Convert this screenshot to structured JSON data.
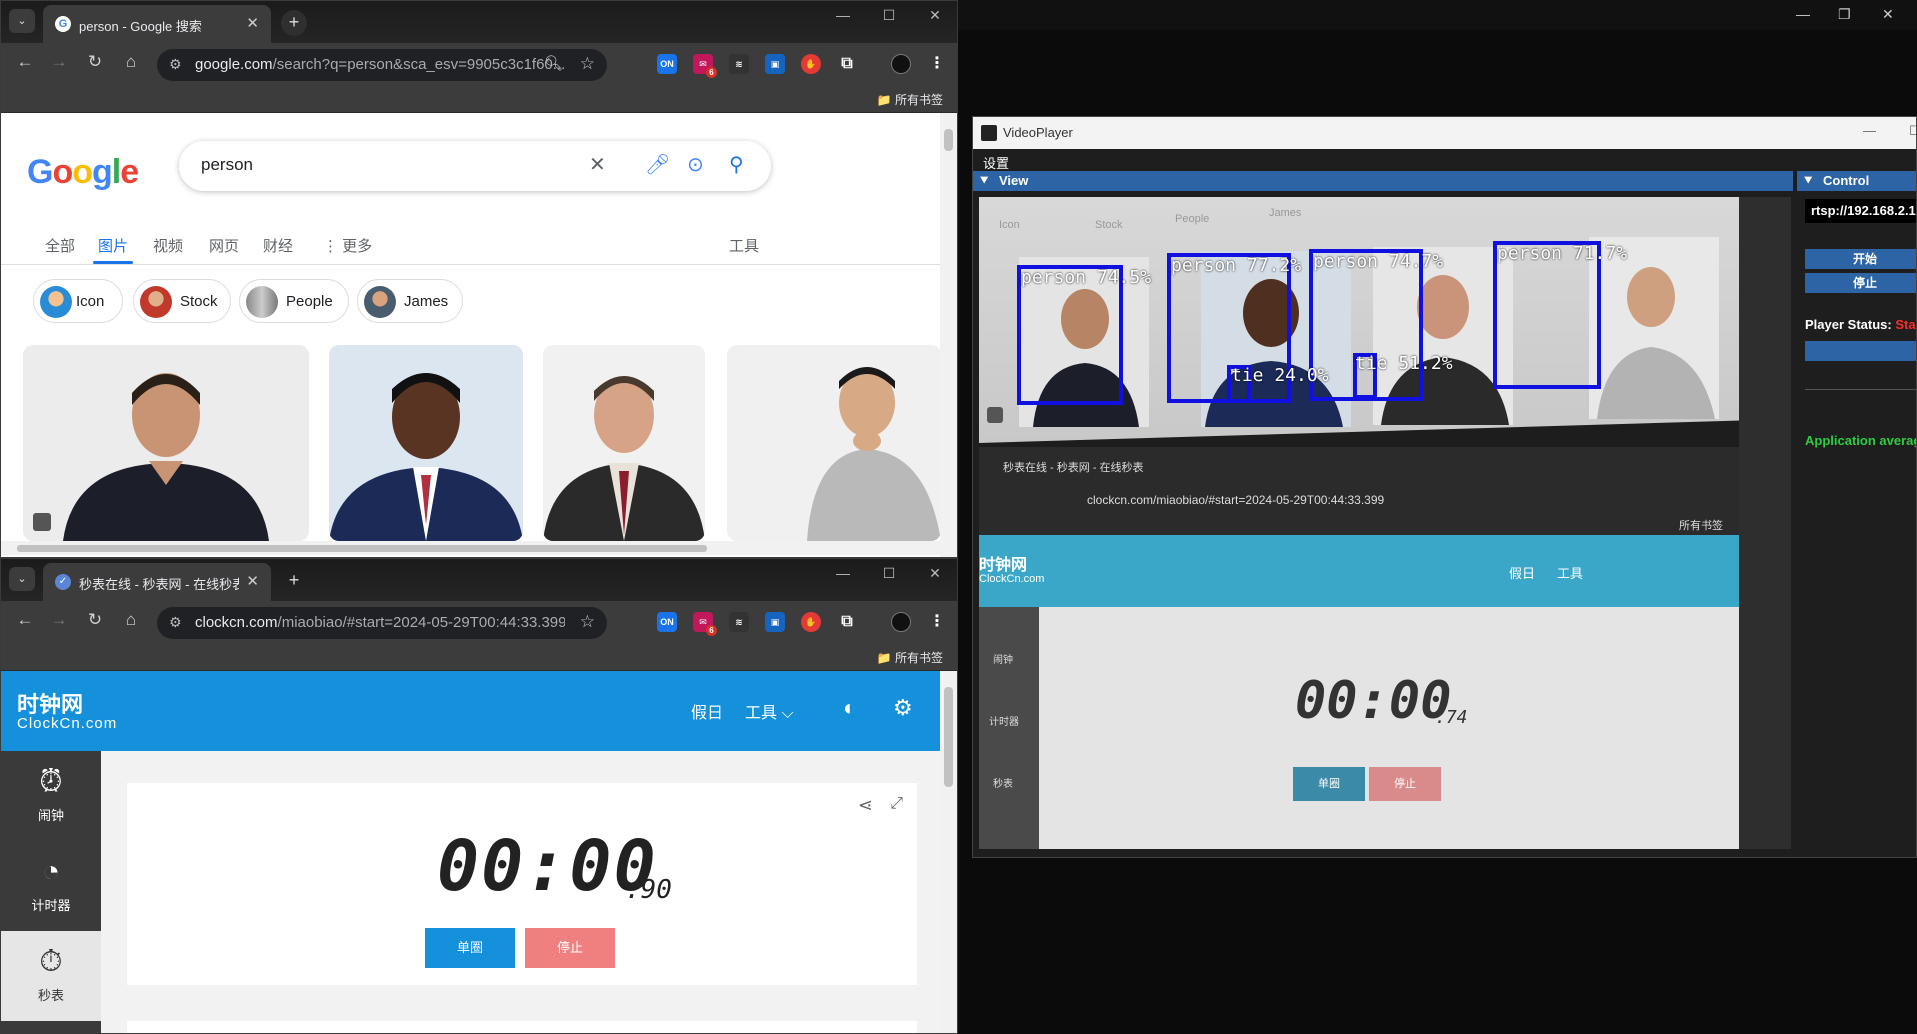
{
  "google_window": {
    "tab_title": "person - Google 搜索",
    "omnibox": {
      "url_main": "google.com",
      "url_rest": "/search?q=person&sca_esv=9905c3c1f60..."
    },
    "bookmarks_all": "所有书签",
    "page": {
      "logo": "Google",
      "query": "person",
      "nav": [
        "全部",
        "图片",
        "视频",
        "网页",
        "财经",
        "更多"
      ],
      "tools": "工具",
      "chips": [
        "Icon",
        "Stock",
        "People",
        "James"
      ]
    }
  },
  "clock_window": {
    "tab_title": "秒表在线 - 秒表网 - 在线秒表",
    "omnibox": {
      "url_main": "clockcn.com",
      "url_rest": "/miaobiao/#start=2024-05-29T00:44:33.399"
    },
    "bookmarks_all": "所有书签",
    "page": {
      "logo_cn": "时钟网",
      "logo_en": "ClockCn.com",
      "nav_holiday": "假日",
      "nav_tools": "工具",
      "sidebar": [
        "闹钟",
        "计时器",
        "秒表"
      ],
      "time": "00:00",
      "ms": ".90",
      "btn_lap": "单圈",
      "btn_stop": "停止"
    }
  },
  "extensions": {
    "on_badge": "ON",
    "mail_count": "6"
  },
  "video_player": {
    "title": "VideoPlayer",
    "menu_settings": "设置",
    "view_dock": "View",
    "control_dock": "Control",
    "rtsp": "rtsp://192.168.2.1",
    "btn_start": "开始",
    "btn_stop": "停止",
    "status_label": "Player Status:",
    "status_value": "Star",
    "app_avg": "Application averag",
    "detections": [
      {
        "label": "person 74.5%"
      },
      {
        "label": "person 77.2%"
      },
      {
        "label": "person 74.7%"
      },
      {
        "label": "person 71.7%"
      },
      {
        "label": "tie 24.0%"
      },
      {
        "label": "tie 51.2%"
      }
    ],
    "video_content": {
      "chips": [
        "Icon",
        "Stock",
        "People",
        "James"
      ],
      "tab_title": "秒表在线 - 秒表网 - 在线秒表",
      "url": "clockcn.com/miaobiao/#start=2024-05-29T00:44:33.399",
      "bookmarks": "所有书签",
      "logo_cn": "时钟网",
      "logo_en": "ClockCn.com",
      "nav_holiday": "假日",
      "nav_tools": "工具",
      "sidebar": [
        "闹钟",
        "计时器",
        "秒表"
      ],
      "time": "00:00",
      "ms": ".74",
      "btn_lap": "单圈",
      "btn_stop": "停止"
    }
  },
  "colors": {
    "accent_blue": "#1a73e8",
    "clock_blue": "#1591dc",
    "detect_blue": "#1010e0",
    "dock_blue": "#2d64a6",
    "status_red": "#ff2a2a",
    "status_green": "#2ecc40"
  }
}
